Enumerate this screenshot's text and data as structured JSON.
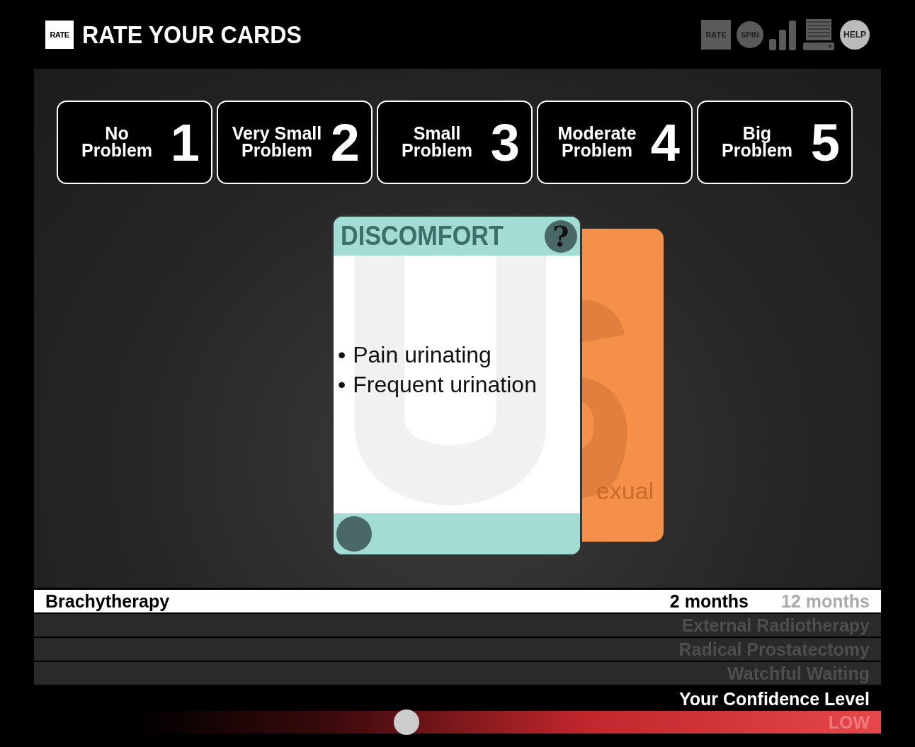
{
  "header": {
    "logo": "RATE",
    "title": "RATE YOUR CARDS",
    "tools": [
      {
        "kind": "square",
        "label": "RATE"
      },
      {
        "kind": "circle",
        "label": "SPIN"
      },
      {
        "kind": "bars"
      },
      {
        "kind": "monitor"
      },
      {
        "kind": "help",
        "label": "HELP"
      }
    ]
  },
  "ratings": [
    {
      "label": "No Problem",
      "number": "1"
    },
    {
      "label": "Very Small Problem",
      "number": "2"
    },
    {
      "label": "Small Problem",
      "number": "3"
    },
    {
      "label": "Moderate Problem",
      "number": "4"
    },
    {
      "label": "Big Problem",
      "number": "5"
    }
  ],
  "card": {
    "title": "DISCOMFORT",
    "help": "?",
    "items": [
      {
        "bullet": "•",
        "text": "Pain urinating"
      },
      {
        "bullet": "•",
        "text": "Frequent urination"
      }
    ]
  },
  "back_card": {
    "label": "exual"
  },
  "treatments": [
    {
      "name": "Brachytherapy",
      "selected": true,
      "durations": [
        {
          "label": "2 months",
          "selected": true
        },
        {
          "label": "12 months",
          "selected": false
        }
      ]
    },
    {
      "name": "External Radiotherapy",
      "selected": false
    },
    {
      "name": "Radical Prostatectomy",
      "selected": false
    },
    {
      "name": "Watchful Waiting",
      "selected": false
    }
  ],
  "confidence": {
    "label": "Your Confidence Level",
    "level": 0.44,
    "reading": "LOW"
  }
}
